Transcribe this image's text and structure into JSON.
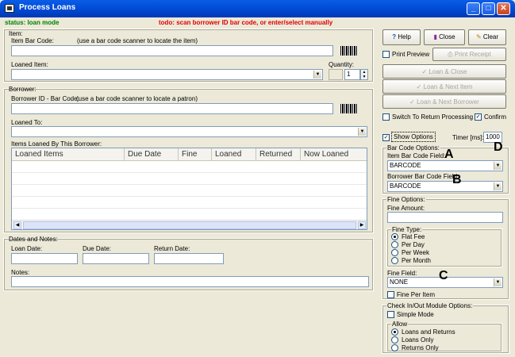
{
  "window": {
    "title": "Process Loans",
    "minimize": "_",
    "maximize": "□",
    "close": "✕"
  },
  "status": {
    "left": "status: loan mode",
    "right": "todo: scan borrower ID bar code, or enter/select manually"
  },
  "item": {
    "group": "Item:",
    "barcode_label": "Item Bar Code:",
    "barcode_hint": "(use a bar code scanner to locate the item)",
    "loaned_item_label": "Loaned Item:",
    "quantity_label": "Quantity:",
    "quantity_value": "1"
  },
  "borrower": {
    "group": "Borrower:",
    "barcode_label": "Borrower ID - Bar Code:",
    "barcode_hint": "(use a bar code scanner to locate a patron)",
    "loaned_to_label": "Loaned To:",
    "items_label": "Items Loaned By This Borrower:",
    "columns": [
      "Loaned Items",
      "Due Date",
      "Fine",
      "Loaned",
      "Returned",
      "Now Loaned"
    ]
  },
  "dates": {
    "group": "Dates and Notes:",
    "loan_date": "Loan Date:",
    "due_date": "Due Date:",
    "return_date": "Return Date:",
    "notes": "Notes:"
  },
  "actions": {
    "help": "Help",
    "close": "Close",
    "clear": "Clear",
    "print_preview": "Print Preview",
    "print_receipt": "Print Receipt",
    "loan_close": "Loan & Close",
    "loan_next_item": "Loan & Next Item",
    "loan_next_borrower": "Loan & Next Borrower",
    "switch_return": "Switch To Return Processing",
    "confirm": "Confirm"
  },
  "options": {
    "show_options": "Show Options",
    "timer_label": "Timer [ms]:",
    "timer_value": "1000",
    "barcode_group": "Bar Code Options:",
    "item_field_label": "Item Bar Code Field:",
    "item_field_value": "BARCODE",
    "borrower_field_label": "Borrower Bar Code Field:",
    "borrower_field_value": "BARCODE"
  },
  "fine": {
    "group": "Fine Options:",
    "amount_label": "Fine Amount:",
    "type_group": "Fine Type:",
    "types": [
      "Flat Fee",
      "Per Day",
      "Per Week",
      "Per Month"
    ],
    "field_label": "Fine Field:",
    "field_value": "NONE",
    "per_item": "Fine Per Item"
  },
  "module": {
    "group": "Check In/Out Module Options:",
    "simple_mode": "Simple Mode",
    "allow_group": "Allow",
    "allow": [
      "Loans and Returns",
      "Loans Only",
      "Returns Only"
    ]
  },
  "annotations": {
    "a": "A",
    "b": "B",
    "c": "C",
    "d": "D"
  },
  "colors": {
    "status_ok": "#008000",
    "status_todo": "#e00000",
    "title_bar": "#0047d0"
  }
}
